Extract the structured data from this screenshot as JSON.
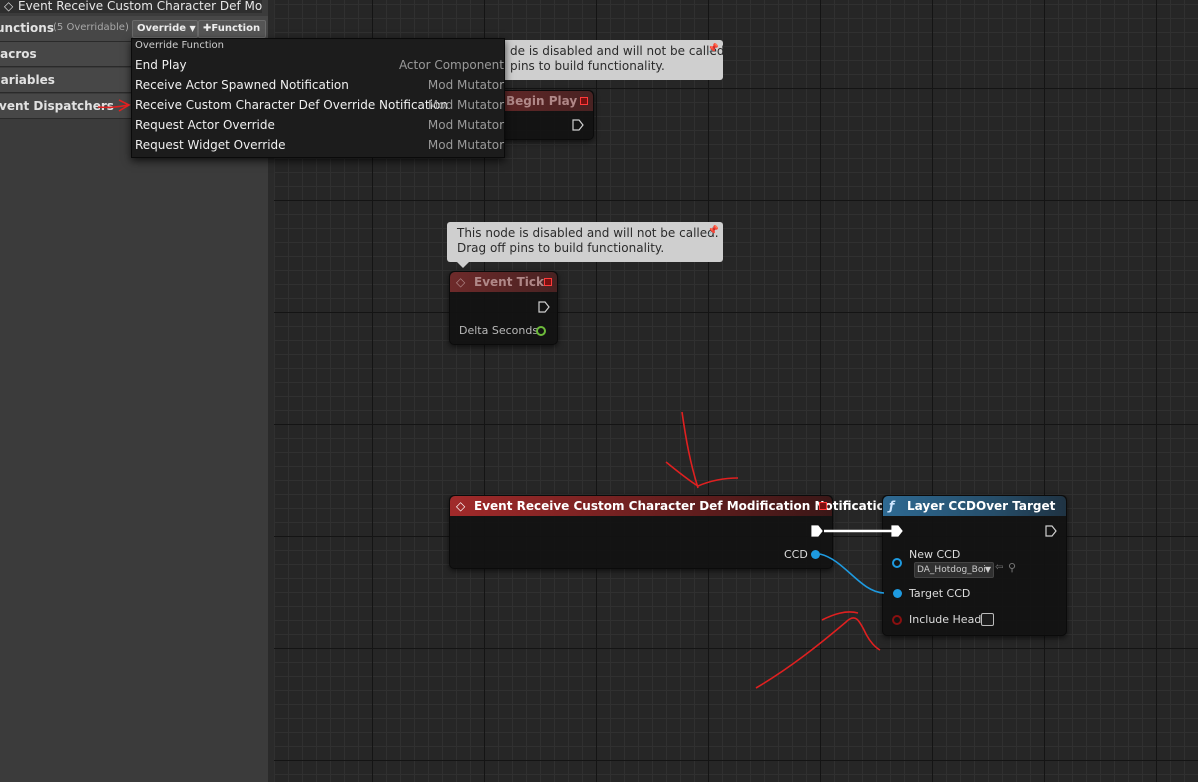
{
  "tab": {
    "title": "Event Receive Custom Character Def Mo"
  },
  "sidebar": {
    "functions_label": "unctions",
    "functions_count": "(5 Overridable)",
    "override_button": "Override",
    "function_button": "Function",
    "macros_label": "lacros",
    "variables_label": "'ariables",
    "dispatchers_label": "vent Dispatchers"
  },
  "override_menu": {
    "header": "Override Function",
    "items": [
      {
        "name": "End Play",
        "category": "Actor Component"
      },
      {
        "name": "Receive Actor Spawned Notification",
        "category": "Mod Mutator"
      },
      {
        "name": "Receive Custom Character Def Override Notification",
        "category": "Mod Mutator"
      },
      {
        "name": "Request Actor Override",
        "category": "Mod Mutator"
      },
      {
        "name": "Request Widget Override",
        "category": "Mod Mutator"
      }
    ]
  },
  "graph": {
    "comment1": {
      "line1": "de is disabled and will not be called.",
      "line2": "pins to build functionality."
    },
    "comment2": {
      "line1": "This node is disabled and will not be called.",
      "line2": "Drag off pins to build functionality."
    },
    "begin_play": {
      "title": "Begin Play"
    },
    "event_tick": {
      "title": "Event Tick",
      "delta_label": "Delta Seconds"
    },
    "custom_event": {
      "title": "Event Receive Custom Character Def Modification Notification",
      "ccd_label": "CCD"
    },
    "layer_node": {
      "title": "Layer CCDOver Target",
      "new_ccd_label": "New CCD",
      "new_ccd_value": "DA_Hotdog_Boi",
      "target_ccd_label": "Target CCD",
      "include_head_label": "Include Head"
    }
  },
  "colors": {
    "event_header": "#a12a2a",
    "function_header": "#2e6a93",
    "object_pin": "#1e9ae0",
    "float_pin": "#6dbb3b",
    "bool_pin": "#8a1010",
    "annotation": "#e02020"
  }
}
